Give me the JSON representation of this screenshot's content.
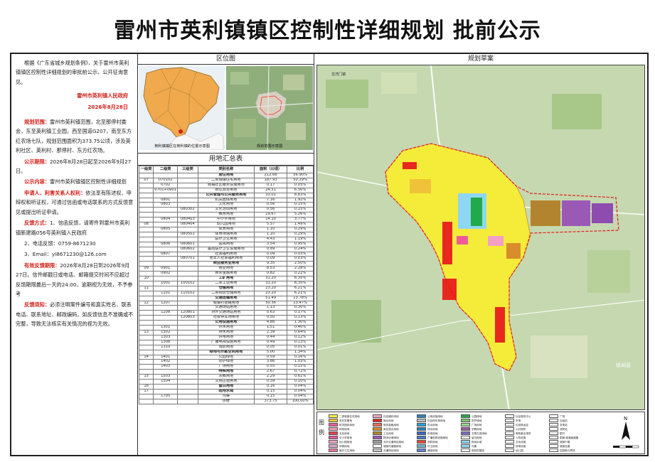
{
  "title": "雷州市英利镇镇区控制性详细规划   批前公示",
  "left": {
    "intro": "根据《广东省城乡规划条例》，关于雷州市英利镇镇区控制性详细规划的审批前公示，公开征询意见。",
    "signer": "雷州市英利镇人民政府",
    "date": "2026年8月28日",
    "scope_label": "规划范围：",
    "scope_text": "雷州市英利镇范围，北至那停村委会，东至英利镇工业园，西至国道G207，南至东方红农场七队，规划范围面积为373.75公顷，涉及英利社区、英利村、那停村、东方红农场。",
    "period_label": "公示期限：",
    "period_text": "2026年8月28日起至2026年9月27日。",
    "content_label": "公示内容：",
    "content_text": "雷州市英利镇镇区控制性详细规划",
    "stake_label": "申请人、利害关系人权利：",
    "stake_text": "依法享有陈述权、申辩权和听证权，可通过信函或电话联系的方式反馈意见或提出听证申请。",
    "ways_label": "反馈方式：",
    "way1": "1、信函反馈，请寄件到雷州市英利镇新建路056号英利镇人民政府",
    "way2": "2、电话反馈：0759-8671230",
    "way3": "3、Email：yl8671230@126.com",
    "valid_label": "有效反馈期限：",
    "valid_text": "2026年8月28日到2026年9月27日。信件邮戳日或电话、邮箱提交时间不应超过反馈期限最后一天的24:00，逾期视为无效，不予参考",
    "notice_label": "反馈须知：",
    "notice_text": "必须注明案件编号和真实姓名、联系电话、联系地址、邮政编码，如反馈信息不准确或不完整，导致无法核实有关情况的视为无效。"
  },
  "mid": {
    "loc_heading": "区位图",
    "loc_cap_a": "英利镇镇区在英利镇的位置示意图",
    "loc_cap_b": "规划范围示意图",
    "table_title": "用地汇总表",
    "headers": [
      "一级类",
      "二级类",
      "三级类",
      "类别名称",
      "面积（公顷）",
      "比例"
    ],
    "rows": [
      [
        "",
        "",
        "",
        "居住用地",
        "212.66",
        "56.90%",
        1
      ],
      [
        "07",
        "070102",
        "",
        "二类城镇住宅用地",
        "187.93",
        "50.29%",
        0
      ],
      [
        "",
        "0702",
        "",
        "城镇社区服务设施用地",
        "0.17",
        "0.05%",
        0
      ],
      [
        "",
        "0701+0901",
        "",
        "商住混合用地",
        "24.51",
        "6.56%",
        0
      ],
      [
        "",
        "",
        "",
        "公共管理与公共服务用地",
        "33.01",
        "8.83%",
        1
      ],
      [
        "",
        "0801",
        "",
        "机关团体用地",
        "7.16",
        "1.92%",
        0
      ],
      [
        "",
        "0803",
        "",
        "文化用地",
        "0.56",
        "0.15%",
        0
      ],
      [
        "",
        "",
        "080302",
        "文化活动用地",
        "0.56",
        "0.15%",
        0
      ],
      [
        "",
        "",
        "",
        "教育用地",
        "19.67",
        "5.26%",
        0
      ],
      [
        "",
        "0804",
        "080403",
        "中小学用地",
        "14.10",
        "3.77%",
        0
      ],
      [
        "08",
        "",
        "080404",
        "幼儿园用地",
        "5.57",
        "1.49%",
        0
      ],
      [
        "",
        "0805",
        "",
        "体育用地",
        "1.10",
        "0.29%",
        0
      ],
      [
        "",
        "",
        "080501",
        "体育场馆用地",
        "1.10",
        "0.29%",
        0
      ],
      [
        "",
        "",
        "",
        "医疗卫生用地",
        "4.43",
        "1.19%",
        0
      ],
      [
        "",
        "0806",
        "080601",
        "医院用地",
        "3.54",
        "0.95%",
        0
      ],
      [
        "",
        "",
        "080602",
        "基层医疗卫生设施用地",
        "0.89",
        "0.24%",
        0
      ],
      [
        "",
        "0807",
        "",
        "社会福利用地",
        "0.09",
        "0.03%",
        0
      ],
      [
        "",
        "",
        "080701",
        "老年人社会福利用地",
        "0.09",
        "0.03%",
        0
      ],
      [
        "",
        "",
        "",
        "商业服务业用地",
        "9.35",
        "2.50%",
        1
      ],
      [
        "09",
        "0901",
        "",
        "商业用地",
        "8.53",
        "2.28%",
        0
      ],
      [
        "",
        "0902",
        "",
        "商务金融用地",
        "0.82",
        "0.22%",
        0
      ],
      [
        "10",
        "",
        "",
        "工矿用地",
        "31.20",
        "8.35%",
        1
      ],
      [
        "",
        "1001",
        "100102",
        "二类工业用地",
        "31.20",
        "8.35%",
        0
      ],
      [
        "11",
        "",
        "",
        "仓储用地",
        "23.20",
        "6.21%",
        1
      ],
      [
        "",
        "1101",
        "110102",
        "二类物流仓储用地",
        "23.20",
        "6.21%",
        0
      ],
      [
        "",
        "",
        "",
        "交通运输用地",
        "51.49",
        "13.78%",
        1
      ],
      [
        "12",
        "1207",
        "",
        "城镇村道路用地",
        "50.36",
        "13.47%",
        0
      ],
      [
        "",
        "",
        "",
        "交通场站用地",
        "1.13",
        "0.30%",
        0
      ],
      [
        "",
        "1208",
        "120801",
        "对外交通场站用地",
        "0.63",
        "0.17%",
        0
      ],
      [
        "",
        "",
        "120803",
        "社会停车场用地",
        "0.50",
        "0.13%",
        0
      ],
      [
        "",
        "",
        "",
        "公用设施用地",
        "4.88",
        "1.30%",
        1
      ],
      [
        "",
        "1301",
        "",
        "供水用地",
        "1.51",
        "0.40%",
        0
      ],
      [
        "13",
        "1302",
        "",
        "排水用地",
        "2.39",
        "0.64%",
        0
      ],
      [
        "",
        "1303",
        "",
        "供电用地",
        "0.44",
        "0.12%",
        0
      ],
      [
        "",
        "1308",
        "",
        "广播电视设施用地",
        "0.49",
        "0.13%",
        0
      ],
      [
        "",
        "1310",
        "",
        "消防用地",
        "0.05",
        "0.01%",
        0
      ],
      [
        "",
        "",
        "",
        "绿地与开敞空间用地",
        "5.00",
        "1.34%",
        1
      ],
      [
        "14",
        "1401",
        "",
        "公园绿地",
        "0.59",
        "0.16%",
        0
      ],
      [
        "",
        "1402",
        "",
        "防护绿地",
        "3.86",
        "1.03%",
        0
      ],
      [
        "",
        "1403",
        "",
        "广场用地",
        "0.55",
        "0.15%",
        0
      ],
      [
        "",
        "",
        "",
        "特殊用地",
        "2.67",
        "0.72%",
        1
      ],
      [
        "15",
        "1503",
        "",
        "宗教用地",
        "2.29",
        "0.61%",
        0
      ],
      [
        "",
        "1504",
        "",
        "文物古迹用地",
        "0.39",
        "0.10%",
        0
      ],
      [
        "16",
        "",
        "",
        "留白用地",
        "0.16",
        "0.04%",
        1
      ],
      [
        "17",
        "",
        "",
        "陆地水域",
        "0.15",
        "0.04%",
        1
      ],
      [
        "",
        "1705",
        "",
        "沟渠",
        "0.15",
        "0.04%",
        0
      ],
      [
        "",
        "",
        "",
        "小计",
        "373.75",
        "100.00%",
        1
      ]
    ]
  },
  "right": {
    "heading": "规划草案",
    "legend_label": "图例",
    "map_labels": [
      "龙湾门镇",
      "徐闻县",
      "英利镇"
    ],
    "legend": [
      [
        "二类城镇住宅用地",
        "#f7f23a"
      ],
      [
        "社会福利用地",
        "#f4a6c8"
      ],
      [
        "公用设施用地",
        "#2d7fc1"
      ],
      [
        "公园绿地",
        "#22a94a"
      ],
      [
        "社区服务中心",
        "#ffffff"
      ],
      [
        "广场",
        "#ffffff"
      ],
      [
        "农村宅基地",
        "#f0c23a"
      ],
      [
        "商业用地",
        "#e8281e"
      ],
      [
        "社会停车场用地",
        "#bdbdbd"
      ],
      [
        "防护绿地",
        "#7cc46a"
      ],
      [
        "市场",
        "#ffffff"
      ],
      [
        "加油站",
        "#ffffff"
      ],
      [
        "机关团体用地",
        "#f05a9b"
      ],
      [
        "商务金融用地",
        "#ee6a5a"
      ],
      [
        "供水用地",
        "#2a9fd8"
      ],
      [
        "广场用地",
        "#9fd39a"
      ],
      [
        "垃圾转运站",
        "#ffffff"
      ],
      [
        "变电站",
        "#ffffff"
      ],
      [
        "科研用地",
        "#f19bb8"
      ],
      [
        "商住混合用地",
        "#d98c2b"
      ],
      [
        "排水用地",
        "#2a7fae"
      ],
      [
        "宗教用地",
        "#9b5aa0"
      ],
      [
        "公共厕所",
        "#ffffff"
      ],
      [
        "消防站",
        "#ffffff"
      ],
      [
        "文化用地",
        "#e4424d"
      ],
      [
        "工业用地",
        "#b2842f"
      ],
      [
        "供电用地",
        "#3a64c8"
      ],
      [
        "文物古迹用地",
        "#7b6cc0"
      ],
      [
        "邮政营业场所",
        "#ffffff"
      ],
      [
        "银行",
        "#ffffff"
      ],
      [
        "中小学用地",
        "#e35aa0"
      ],
      [
        "物流仓储用地",
        "#9b59b6"
      ],
      [
        "广播电视设施用地",
        "#4d79c9"
      ],
      [
        "留白用地",
        "#ffffff"
      ],
      [
        "人防设施",
        "#ffffff"
      ],
      [
        "国家/省道级道路",
        "#ffffff"
      ],
      [
        "幼儿园用地",
        "#f2a0c5"
      ],
      [
        "对外交通场站用地",
        "#9e9e9e"
      ],
      [
        "消防用地",
        "#e84a3a"
      ],
      [
        "陆地水域",
        "#8fd6f2"
      ],
      [
        "文化设施",
        "#ffffff"
      ],
      [
        "城镇干路",
        "#ffffff"
      ],
      [
        "体育用地",
        "#d7a7d0"
      ],
      [
        "城镇村道路用地",
        "#ffffff"
      ],
      [
        "环卫用地",
        "#6bb2c8"
      ],
      [
        "沟渠",
        "#8fd6f2"
      ],
      [
        "体育设施",
        "#ffffff"
      ],
      [
        "城镇支路",
        "#ffffff"
      ],
      [
        "医疗卫生用地",
        "#ee7799"
      ],
      [
        "交通场站用地",
        "#c8c8c8"
      ],
      [
        "通信用地",
        "#5e89cf"
      ],
      [
        "规划范围线",
        "#ffffff"
      ],
      [
        "幼儿园",
        "#ffffff"
      ],
      [
        "控制单元界线",
        "#ffffff"
      ]
    ]
  }
}
